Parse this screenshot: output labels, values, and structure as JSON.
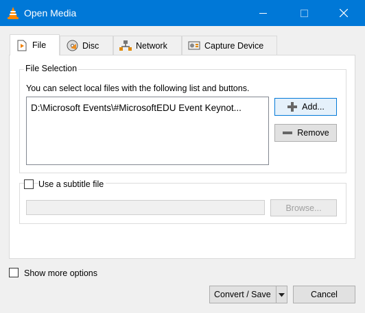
{
  "window": {
    "title": "Open Media",
    "accent": "#0078d7",
    "icons": {
      "app": "vlc-cone-icon",
      "minimize": "minimize-icon",
      "maximize": "maximize-icon",
      "close": "close-icon"
    }
  },
  "tabs": [
    {
      "label": "File",
      "icon": "file-icon",
      "active": true
    },
    {
      "label": "Disc",
      "icon": "disc-icon",
      "active": false
    },
    {
      "label": "Network",
      "icon": "network-icon",
      "active": false
    },
    {
      "label": "Capture Device",
      "icon": "capture-device-icon",
      "active": false
    }
  ],
  "file_selection": {
    "legend": "File Selection",
    "hint": "You can select local files with the following list and buttons.",
    "files": [
      "D:\\Microsoft Events\\#MicrosoftEDU Event Keynot..."
    ],
    "add_label": "Add...",
    "remove_label": "Remove"
  },
  "subtitle": {
    "label": "Use a subtitle file",
    "checked": false,
    "path_value": "",
    "browse_label": "Browse..."
  },
  "show_more": {
    "label": "Show more options",
    "checked": false
  },
  "footer": {
    "convert_label": "Convert / Save",
    "cancel_label": "Cancel"
  }
}
